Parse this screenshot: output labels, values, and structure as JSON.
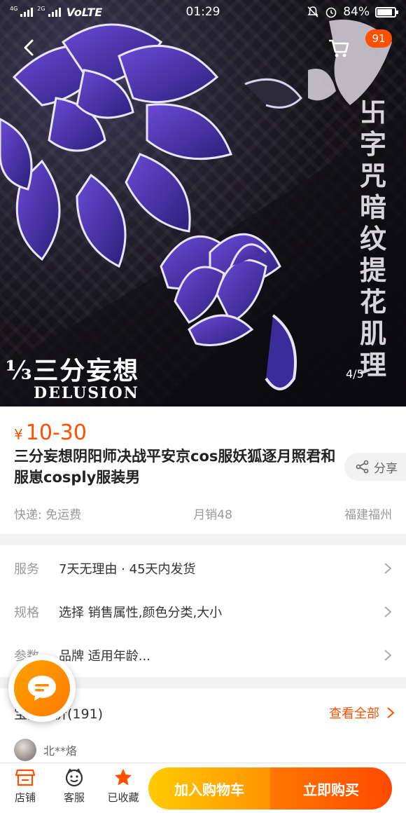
{
  "status_bar": {
    "network_small": "4G",
    "network_small2": "2G",
    "carrier": "VoLTE",
    "time": "01:29",
    "battery": "84%"
  },
  "header": {
    "cart_badge": "91",
    "back_icon": "chevron-left-icon",
    "cart_icon": "cart-icon"
  },
  "hero": {
    "vertical_text": [
      "卐",
      "字",
      "咒",
      "暗",
      "纹",
      "提",
      "花",
      "肌",
      "理"
    ],
    "brand_cn": "⅓三分妄想",
    "brand_en": "DELUSION",
    "page_indicator": "4/5"
  },
  "product": {
    "price_symbol": "¥",
    "price": "10-30",
    "title": "三分妄想阴阳师决战平安京cos服妖狐逐月照君和服崽cosply服装男",
    "share_label": "分享",
    "shipping": "快递: 免运费",
    "monthly_sales": "月销48",
    "location": "福建福州"
  },
  "options": {
    "service_label": "服务",
    "service_value": "7天无理由 · 45天内发货",
    "spec_label": "规格",
    "spec_value": "选择 销售属性,颜色分类,大小",
    "param_label": "参数",
    "param_value": "品牌 适用年龄..."
  },
  "reviews": {
    "title": "宝贝评价(191)",
    "view_all": "查看全部",
    "reviewer_name": "北**烙"
  },
  "bottom_bar": {
    "shop": "店铺",
    "service": "客服",
    "favorite": "已收藏",
    "add_to_cart": "加入购物车",
    "buy_now": "立即购买"
  },
  "colors": {
    "accent": "#ff5000",
    "cart_gradient_start": "#ffcb00",
    "buy_gradient_end": "#ff4900"
  }
}
